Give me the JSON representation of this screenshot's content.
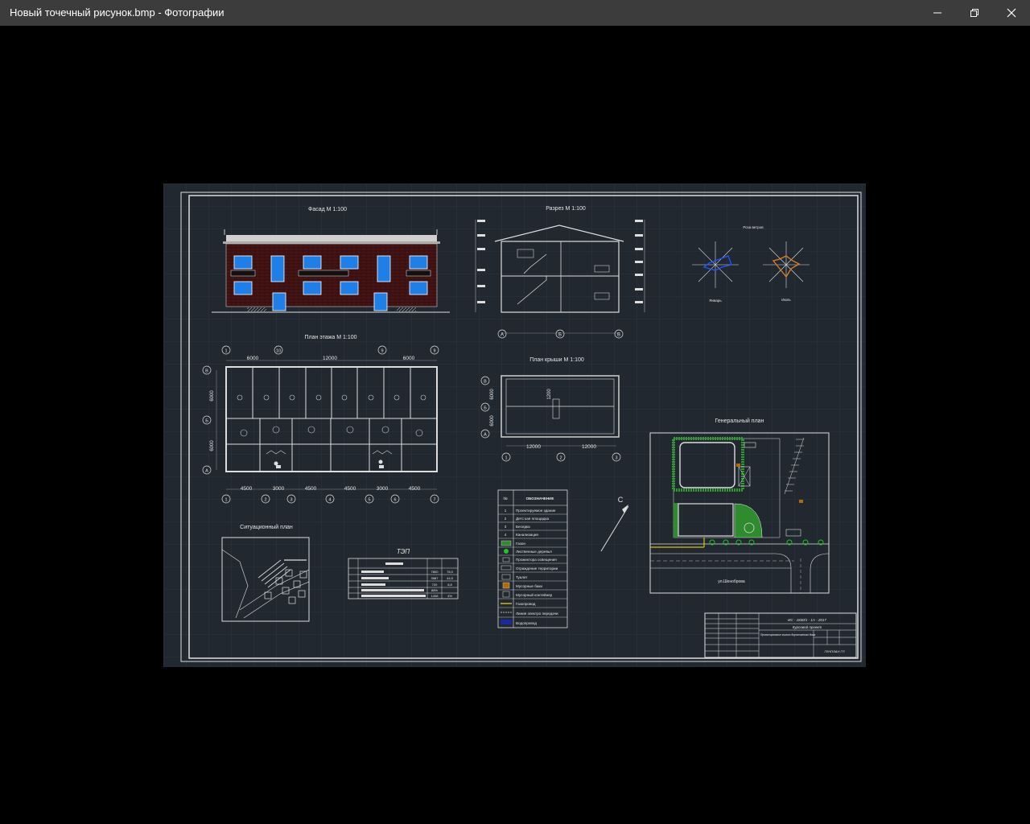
{
  "window": {
    "title": "Новый точечный рисунок.bmp - Фотографии",
    "minimize_icon": "minimize-icon",
    "maximize_icon": "restore-icon",
    "close_icon": "close-icon"
  },
  "drawing": {
    "facade_title": "Фасад М 1:100",
    "section_title": "Разрез М 1:100",
    "floor_plan_title": "План этажа М 1:100",
    "roof_plan_title": "План крыши М 1:100",
    "site_plan_title": "Генеральный план",
    "situation_plan_title": "Ситуационный план",
    "tep_title": "ТЭП",
    "north_label": "С",
    "street_label": "ул.Шеноброва",
    "floor_dims_top": [
      "6000",
      "12000",
      "6000"
    ],
    "floor_dims_bottom": [
      "4500",
      "3000",
      "4500",
      "4500",
      "3000",
      "4500"
    ],
    "floor_axes_top": [
      "1",
      "10",
      "9",
      "9"
    ],
    "floor_axes_bottom": [
      "1",
      "2",
      "3",
      "4",
      "5",
      "6",
      "7"
    ],
    "floor_axes_side": [
      "В",
      "Б",
      "А"
    ],
    "floor_dims_side": [
      "6000",
      "6000"
    ],
    "roof_dims_bottom": [
      "12000",
      "12000"
    ],
    "roof_axes_bottom": [
      "1",
      "2",
      "3"
    ],
    "roof_axes_side": [
      "В",
      "Б",
      "А"
    ],
    "roof_dims_side": [
      "6000",
      "6000"
    ],
    "roof_inner_dim": "1200",
    "section_axes": [
      "А",
      "Б",
      "В"
    ],
    "legend": {
      "header_no": "№",
      "header_name": "ОБОЗНАЧЕНИЕ",
      "items": [
        {
          "no": "1",
          "text": "Проектируемое здание"
        },
        {
          "no": "2",
          "text": "Детс кая площадка"
        },
        {
          "no": "3",
          "text": "Беседка"
        },
        {
          "no": "4",
          "text": "Канализация"
        },
        {
          "no": "",
          "text": "Газон"
        },
        {
          "no": "",
          "text": "Лиственные деревья"
        },
        {
          "no": "",
          "text": "Прожектора освещения"
        },
        {
          "no": "",
          "text": "Ограждение территории"
        },
        {
          "no": "",
          "text": "Туалет"
        },
        {
          "no": "",
          "text": "Мусорные баки"
        },
        {
          "no": "",
          "text": "Мусорный контейнер"
        },
        {
          "no": "",
          "text": "Газопровод"
        },
        {
          "no": "",
          "text": "Линия электро передачи"
        },
        {
          "no": "",
          "text": "Водопровод"
        }
      ]
    },
    "tep_values": [
      "7800",
      "3987",
      "720",
      "88%",
      "1498"
    ],
    "tep_values_2": [
      "78,0",
      "44,5",
      "8,8",
      "",
      "4%"
    ],
    "title_block": {
      "code": "ИС - 1830/1 - 1А - 2017",
      "name": "Курсовой проект",
      "line1": "Проектирование жилого двухэтажного дома",
      "sheet": "ГЕНПЛАН ГП"
    },
    "wind_label_1": "Январь",
    "wind_label_2": "Июль",
    "wind_title": "Роза ветров"
  }
}
